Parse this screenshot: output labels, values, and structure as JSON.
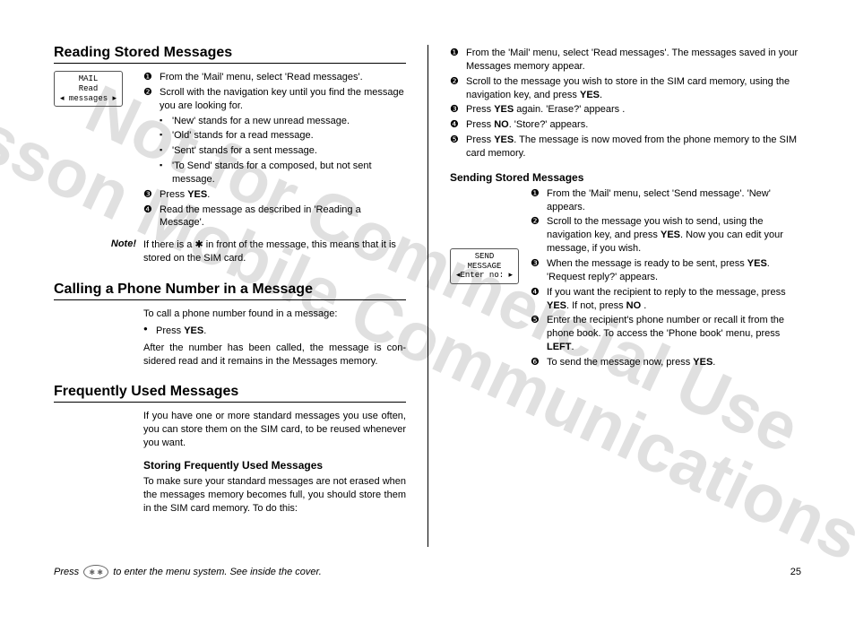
{
  "watermark": {
    "line1": "Not for Commercial Use",
    "line2": "Ericsson Mobile Communications AB"
  },
  "leftColumn": {
    "section1": {
      "title": "Reading Stored Messages",
      "screenBox": "MAIL\nRead\n◂ messages ▸",
      "step1": "From the 'Mail' menu, select 'Read messages'.",
      "step2": "Scroll with the navigation key until you find the message you are looking for.",
      "sub_a": "'New' stands for a new unread message.",
      "sub_b": "'Old' stands for a read message.",
      "sub_c": "'Sent' stands for a sent message.",
      "sub_d": "'To Send' stands for a composed, but not sent message.",
      "step3_pre": "Press ",
      "step3_key": "YES",
      "step3_post": ".",
      "step4": "Read the message as described in 'Reading a Message'.",
      "noteLabel": "Note!",
      "noteText": "If there is a ✱ in front of the message, this means that it is stored on the SIM card."
    },
    "section2": {
      "title": "Calling a Phone Number in a Message",
      "intro": "To call a phone number found in a message:",
      "bullet_pre": "Press ",
      "bullet_key": "YES",
      "bullet_post": ".",
      "after": "After the number has been called, the message is con­sidered read and it remains in the Messages memory."
    },
    "section3": {
      "title": "Frequently Used Messages",
      "intro": "If you have one or more standard messages you use often, you can store them on the SIM card, to be reused whenever you want.",
      "subheading": "Storing Frequently Used Messages",
      "subtext": "To make sure your standard messages are not erased when the messages memory becomes full, you should store them in the SIM card memory. To do this:"
    }
  },
  "rightColumn": {
    "storing": {
      "step1": "From the 'Mail' menu, select 'Read messages'. The messages saved in your Messages memory appear.",
      "step2_pre": "Scroll to the message you wish to store in the SIM card memory, using the navigation key, and press ",
      "step2_key": "YES",
      "step2_post": ".",
      "step3_pre": "Press ",
      "step3_key": "YES",
      "step3_post": " again. 'Erase?' appears .",
      "step4_pre": "Press ",
      "step4_key": "NO",
      "step4_post": ". 'Store?' appears.",
      "step5_pre": "Press ",
      "step5_key": "YES",
      "step5_post": ". The message is now moved from the phone memory to the SIM card memory."
    },
    "sending": {
      "subheading": "Sending Stored Messages",
      "screenBox": "SEND\nMESSAGE\n◂Enter no: ▸",
      "step1": "From the 'Mail' menu, select 'Send message'. 'New' appears.",
      "step2_a": "Scroll to the message you wish to send, using the navigation key, and press ",
      "step2_key": "YES",
      "step2_b": ". Now you can edit your message, if you wish.",
      "step3_a": "When the message is ready to be sent, press ",
      "step3_key": "YES",
      "step3_b": ". 'Request reply?' appears.",
      "step4_a": "If you want the recipient to reply to the message, press ",
      "step4_key1": "YES",
      "step4_b": ". If not, press ",
      "step4_key2": "NO",
      "step4_c": " .",
      "step5_a": "Enter the recipient's phone number or recall it from the phone book. To access the 'Phone book' menu, press ",
      "step5_key": "LEFT",
      "step5_b": ".",
      "step6_a": "To send the message now, press ",
      "step6_key": "YES",
      "step6_b": "."
    }
  },
  "footer": {
    "leftPre": "Press ",
    "leftPost": " to enter the menu system. See inside the cover.",
    "pageNumber": "25"
  }
}
